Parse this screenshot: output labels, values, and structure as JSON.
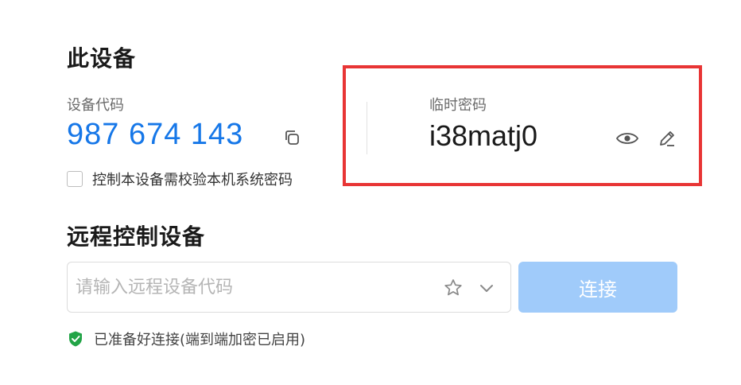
{
  "this_device": {
    "title": "此设备",
    "code_label": "设备代码",
    "code": "987 674 143",
    "checkbox_label": "控制本设备需校验本机系统密码",
    "checkbox_checked": false
  },
  "temp_password": {
    "label": "临时密码",
    "value": "i38matj0"
  },
  "remote": {
    "title": "远程控制设备",
    "input_placeholder": "请输入远程设备代码",
    "input_value": "",
    "connect_label": "连接",
    "status_text": "已准备好连接(端到端加密已启用)"
  },
  "colors": {
    "accent": "#1677e8",
    "connect_button_disabled": "#a0cbfa",
    "highlight_border": "#e83535",
    "status_ok": "#22a447"
  }
}
